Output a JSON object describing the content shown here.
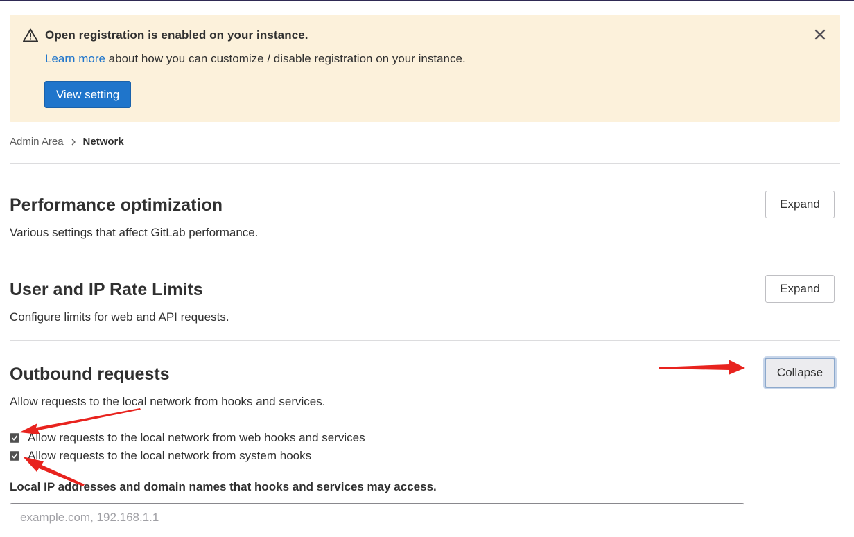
{
  "alert": {
    "title": "Open registration is enabled on your instance.",
    "link": "Learn more",
    "body": " about how you can customize / disable registration on your instance.",
    "button": "View setting",
    "icon": "warning-icon",
    "close_icon": "close-icon"
  },
  "breadcrumb": {
    "items": [
      "Admin Area",
      "Network"
    ]
  },
  "sections": [
    {
      "title": "Performance optimization",
      "description": "Various settings that affect GitLab performance.",
      "button": "Expand"
    },
    {
      "title": "User and IP Rate Limits",
      "description": "Configure limits for web and API requests.",
      "button": "Expand"
    },
    {
      "title": "Outbound requests",
      "description": "Allow requests to the local network from hooks and services.",
      "button": "Collapse"
    }
  ],
  "outbound": {
    "checkboxes": [
      {
        "label": "Allow requests to the local network from web hooks and services",
        "checked": true
      },
      {
        "label": "Allow requests to the local network from system hooks",
        "checked": true
      }
    ],
    "field_label": "Local IP addresses and domain names that hooks and services may access.",
    "field_placeholder": "example.com, 192.168.1.1",
    "field_value": ""
  },
  "colors": {
    "primary": "#1f75cb",
    "alert_bg": "#fcf1db",
    "annotation_arrow": "#e8231e"
  }
}
